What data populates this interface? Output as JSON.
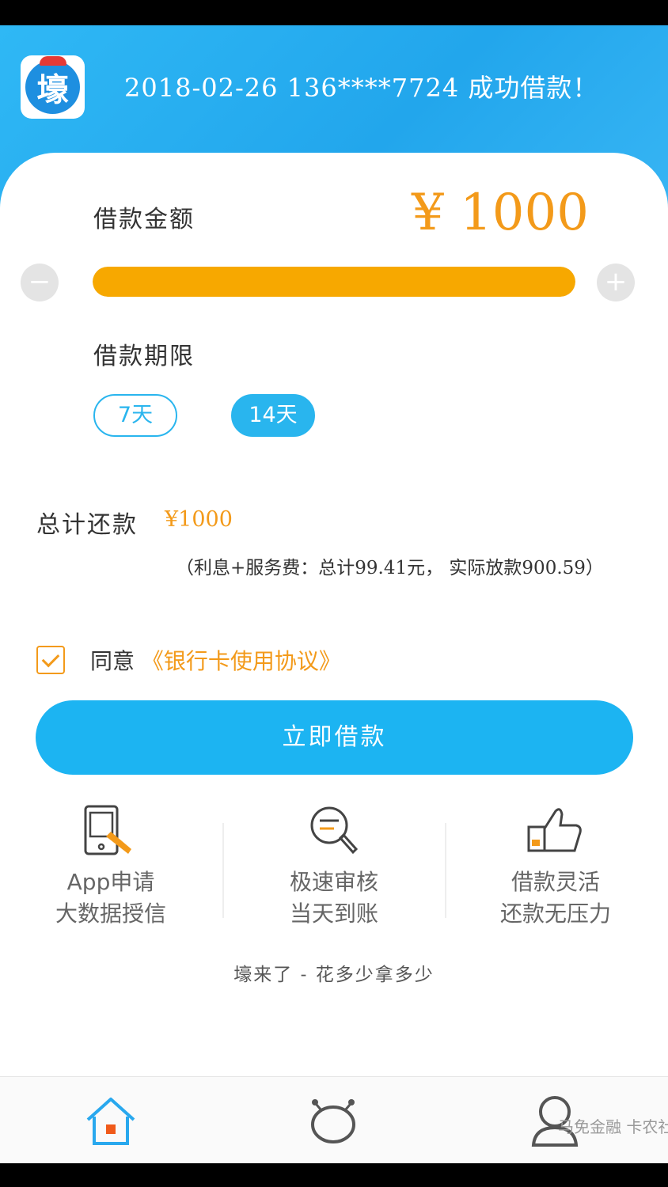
{
  "header": {
    "logo_glyph": "壕",
    "ticker": "2018-02-26 136****7724 成功借款！"
  },
  "loan": {
    "amount_label": "借款金额",
    "amount_value": "¥ 1000",
    "slider_fraction": 1.0,
    "minus_symbol": "−",
    "plus_symbol": "+",
    "term_label": "借款期限",
    "terms": [
      {
        "label": "7天",
        "selected": false
      },
      {
        "label": "14天",
        "selected": true
      }
    ],
    "total_label": "总计还款",
    "total_value": "¥1000",
    "fee_note": "（利息+服务费：总计99.41元， 实际放款900.59）"
  },
  "agreement": {
    "agree_text": "同意",
    "link_text": "《银行卡使用协议》",
    "checked": true
  },
  "submit": {
    "label": "立即借款"
  },
  "features": [
    {
      "line1": "App申请",
      "line2": "大数据授信",
      "icon": "tablet-tap-icon"
    },
    {
      "line1": "极速审核",
      "line2": "当天到账",
      "icon": "magnifier-icon"
    },
    {
      "line1": "借款灵活",
      "line2": "还款无压力",
      "icon": "thumbs-up-icon"
    }
  ],
  "slogan": "壕来了 - 花多少拿多少",
  "tabs": [
    {
      "icon": "home-icon"
    },
    {
      "icon": "discover-icon"
    },
    {
      "icon": "user-icon"
    }
  ],
  "watermark": "马免金融 卡农社区",
  "colors": {
    "primary": "#1cb4f2",
    "accent": "#f39a1a",
    "slider": "#f7a800"
  }
}
